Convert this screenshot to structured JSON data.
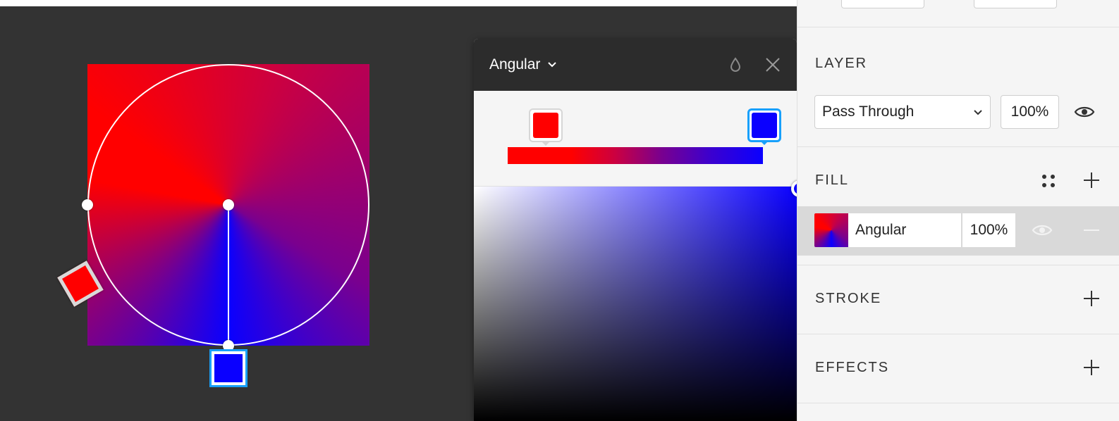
{
  "canvas": {
    "stops": [
      {
        "color": "#ff0000"
      },
      {
        "color": "#0a00ff"
      }
    ]
  },
  "picker": {
    "gradient_type": "Angular",
    "stops": [
      {
        "name": "red",
        "color": "#ff0000"
      },
      {
        "name": "blue",
        "color": "#0a00ff",
        "selected": true
      }
    ],
    "selected_color": "#0a00ff"
  },
  "layer": {
    "title": "LAYER",
    "blend_mode": "Pass Through",
    "opacity": "100%"
  },
  "fill": {
    "title": "FILL",
    "type": "Angular",
    "opacity": "100%"
  },
  "stroke": {
    "title": "STROKE"
  },
  "effects": {
    "title": "EFFECTS"
  },
  "colors": {
    "accent": "#18a0fb",
    "red": "#ff0000",
    "blue": "#0a00ff",
    "panel_bg": "#f5f5f5",
    "canvas_bg": "#333333"
  },
  "icons": {
    "picker_dropdown": "chevron-down-icon",
    "picker_eyedropper": "drop-icon",
    "picker_close": "close-icon",
    "layer_visibility": "eye-icon",
    "fill_styles": "four-dots-icon",
    "fill_visibility": "eye-icon",
    "fill_remove": "minus-icon",
    "add": "plus-icon"
  }
}
